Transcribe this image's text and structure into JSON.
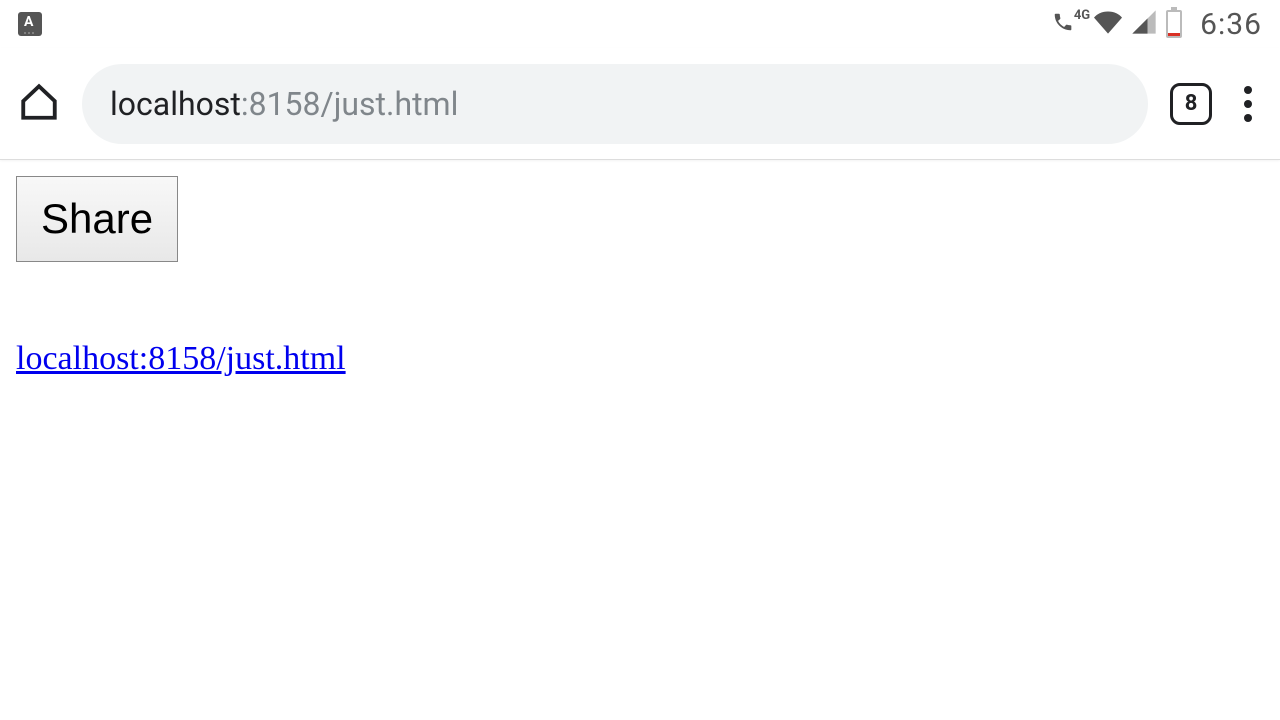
{
  "status": {
    "network_label": "4G",
    "time": "6:36"
  },
  "browser": {
    "url_host": "localhost",
    "url_path": ":8158/just.html",
    "tab_count": "8"
  },
  "page": {
    "share_button_label": "Share",
    "link_text": "localhost:8158/just.html"
  }
}
